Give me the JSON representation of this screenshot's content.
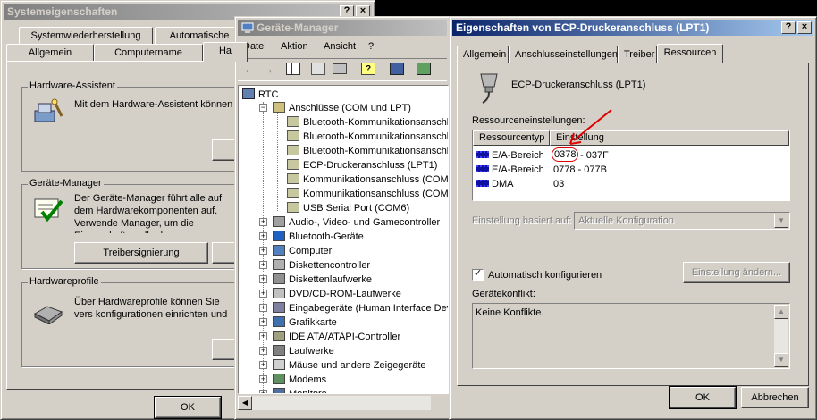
{
  "sys_window": {
    "title": "Systemeigenschaften",
    "tabs_row1": [
      "Systemwiederherstellung",
      "Automatische"
    ],
    "tabs_row2": [
      "Allgemein",
      "Computername",
      "Ha"
    ],
    "hw_assistant": {
      "group_title": "Hardware-Assistent",
      "text": "Mit dem Hardware-Assistent können S",
      "button": "H"
    },
    "device_manager": {
      "group_title": "Geräte-Manager",
      "text": "Der Geräte-Manager führt alle auf dem Hardwarekomponenten auf. Verwende Manager, um die Eigenschaften aller k",
      "driver_signing_button": "Treibersignierung"
    },
    "hw_profiles": {
      "group_title": "Hardwareprofile",
      "text": "Über Hardwareprofile können Sie vers konfigurationen einrichten und speich"
    },
    "ok_button": "OK"
  },
  "devmgr_window": {
    "title": "Geräte-Manager",
    "menu": [
      "Datei",
      "Aktion",
      "Ansicht",
      "?"
    ],
    "tree": {
      "root": "RTC",
      "expanded_category": "Anschlüsse (COM und LPT)",
      "ports": [
        "Bluetooth-Kommunikationsanschl",
        "Bluetooth-Kommunikationsanschl",
        "Bluetooth-Kommunikationsanschl",
        "ECP-Druckeranschluss (LPT1)",
        "Kommunikationsanschluss (COM1",
        "Kommunikationsanschluss (COM2",
        "USB Serial Port (COM6)"
      ],
      "categories": [
        "Audio-, Video- und Gamecontroller",
        "Bluetooth-Geräte",
        "Computer",
        "Diskettencontroller",
        "Diskettenlaufwerke",
        "DVD/CD-ROM-Laufwerke",
        "Eingabegeräte (Human Interface Dev",
        "Grafikkarte",
        "IDE ATA/ATAPI-Controller",
        "Laufwerke",
        "Mäuse und andere Zeigegeräte",
        "Modems",
        "Monitore"
      ]
    }
  },
  "props_window": {
    "title": "Eigenschaften von ECP-Druckeranschluss (LPT1)",
    "tabs": [
      "Allgemein",
      "Anschlusseinstellungen",
      "Treiber",
      "Ressourcen"
    ],
    "device_name": "ECP-Druckeranschluss (LPT1)",
    "resource_settings_label": "Ressourceneinstellungen:",
    "columns": [
      "Ressourcentyp",
      "Einstellung"
    ],
    "rows": [
      {
        "type": "E/A-Bereich",
        "setting_a": "0378",
        "setting_b": " - 037F"
      },
      {
        "type": "E/A-Bereich",
        "setting_a": "0778 - 077B",
        "setting_b": ""
      },
      {
        "type": "DMA",
        "setting_a": "03",
        "setting_b": ""
      }
    ],
    "based_on_label": "Einstellung basiert auf:",
    "based_on_value": "Aktuelle Konfiguration",
    "auto_config_label": "Automatisch konfigurieren",
    "change_setting_button": "Einstellung ändern...",
    "conflict_label": "Gerätekonflikt:",
    "conflict_text": "Keine Konflikte.",
    "ok_button": "OK",
    "cancel_button": "Abbrechen"
  }
}
